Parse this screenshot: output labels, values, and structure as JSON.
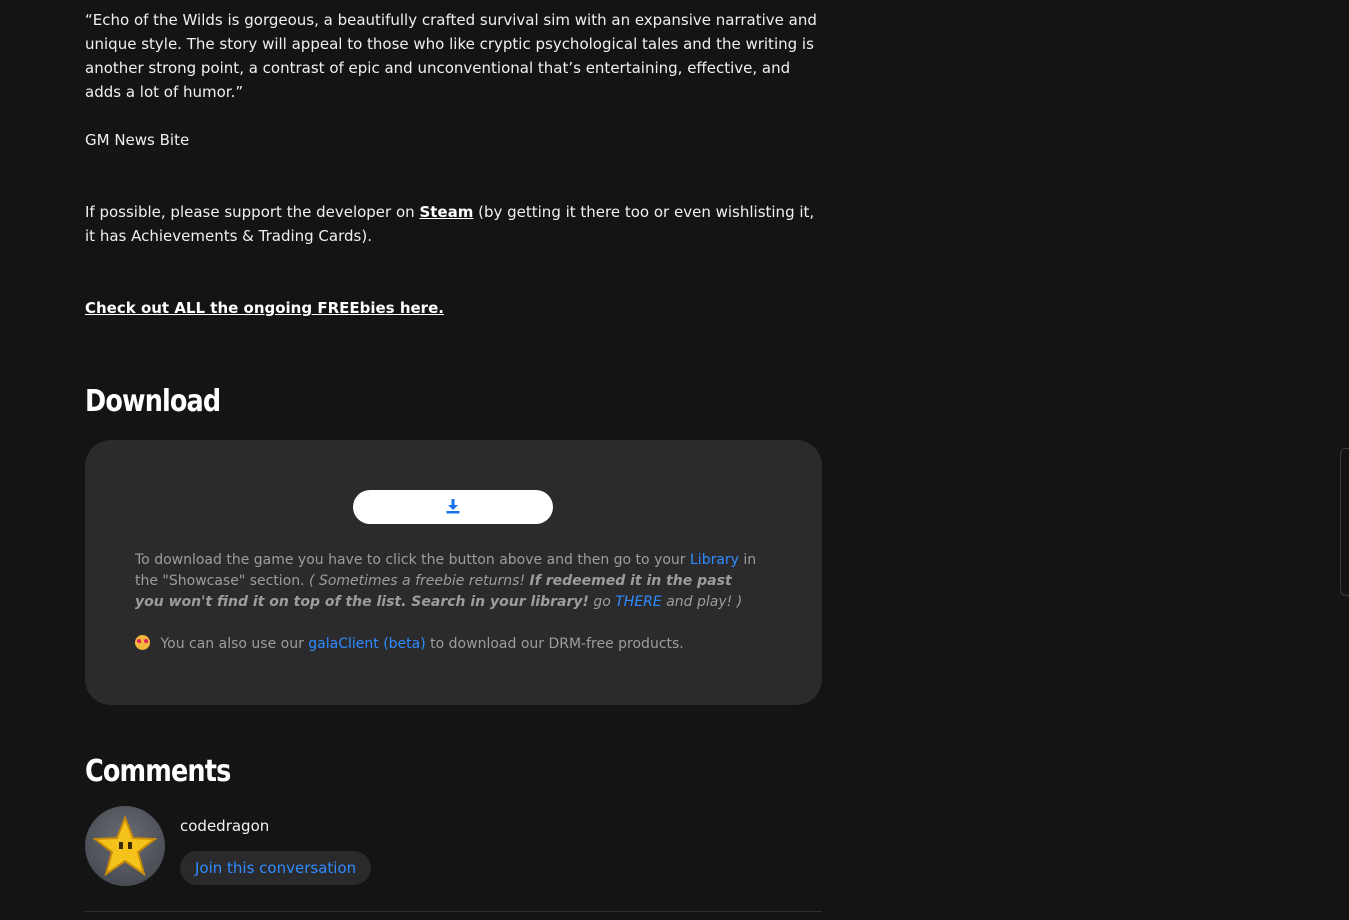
{
  "quote": "“Echo of the Wilds is gorgeous, a beautifully crafted survival sim with an expansive narrative and unique style. The story will appeal to those who like cryptic psychological tales and the writing is another strong point, a contrast of epic and unconventional that’s entertaining, effective, and adds a lot of humor.”",
  "quote_source": "GM News Bite",
  "support": {
    "prefix": "If possible, please support the developer on ",
    "link": "Steam",
    "suffix": " (by getting it there too or even wishlisting it, it has Achievements & Trading Cards)."
  },
  "freebies_link": "Check out ALL the ongoing FREEbies here.",
  "download": {
    "heading": "Download",
    "button_icon": "download-icon",
    "text_1": "To download the game you have to click the button above and then go to your ",
    "library_link": "Library",
    "text_2": " in the \"Showcase\" section. ",
    "italic_1": "( Sometimes a freebie returns! ",
    "bold_italic": "If redeemed it in the past you won't find it on top of the list. Search in your library!",
    "italic_2": " go ",
    "there_link": "THERE",
    "italic_3": " and play! )",
    "client_prefix": " You can also use our ",
    "client_link": "galaClient (beta)",
    "client_suffix": " to download our DRM-free products."
  },
  "comments": {
    "heading": "Comments",
    "username": "codedragon",
    "join_button": "Join this conversation"
  },
  "colors": {
    "background": "#141414",
    "card": "#2b2b2e",
    "link": "#2f8cff",
    "muted_text": "#9d9d9d"
  }
}
